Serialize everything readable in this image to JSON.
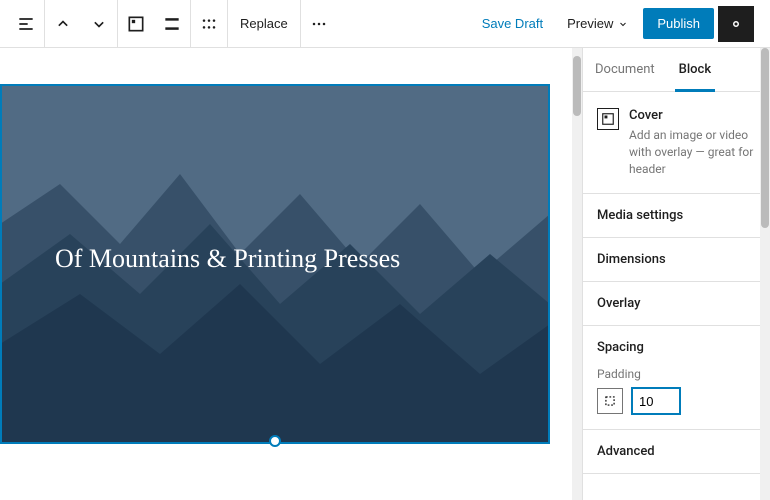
{
  "toolbar": {
    "replace_label": "Replace",
    "save_draft_label": "Save Draft",
    "preview_label": "Preview",
    "publish_label": "Publish"
  },
  "cover": {
    "heading": "Of Mountains & Printing Presses"
  },
  "sidebar": {
    "tabs": {
      "document": "Document",
      "block": "Block"
    },
    "block_header": {
      "title": "Cover",
      "description": "Add an image or video with overlay — great for header"
    },
    "sections": {
      "media_settings": "Media settings",
      "dimensions": "Dimensions",
      "overlay": "Overlay",
      "spacing": "Spacing",
      "advanced": "Advanced"
    },
    "spacing_panel": {
      "padding_label": "Padding",
      "padding_value": "10"
    }
  }
}
